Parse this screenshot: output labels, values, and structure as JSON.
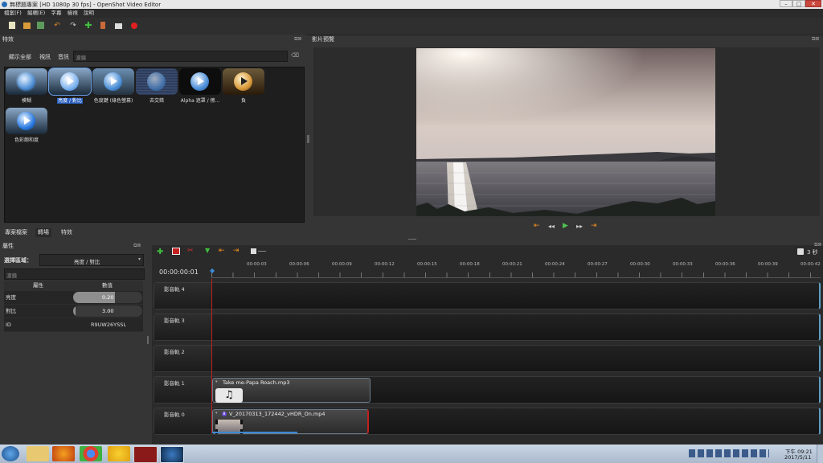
{
  "window": {
    "title": "無標題專案 [HD 1080p 30 fps] - OpenShot Video Editor"
  },
  "menu": [
    "檔案(F)",
    "編輯(E)",
    "字幕",
    "檢視",
    "說明"
  ],
  "effects": {
    "title": "特效",
    "filters": {
      "show_all": "顯示全部",
      "video": "視訊",
      "audio": "音訊",
      "search_placeholder": "濾鏡"
    },
    "items": [
      {
        "label": "模糊",
        "selected": false
      },
      {
        "label": "亮度 / 對比",
        "selected": true
      },
      {
        "label": "色度鍵 (綠色螢幕)",
        "selected": false
      },
      {
        "label": "去交錯",
        "selected": false
      },
      {
        "label": "Alpha 遮罩 / 擦...",
        "selected": false
      },
      {
        "label": "負",
        "selected": false
      },
      {
        "label": "色彩飽和度",
        "selected": false
      }
    ]
  },
  "preview": {
    "title": "影片預覽"
  },
  "tabs": {
    "project_files": "專案檔案",
    "transitions": "轉場",
    "effects": "特效"
  },
  "properties": {
    "title": "屬性",
    "selection_label": "選擇區域：",
    "selection_value": "亮度 / 對比",
    "filter_placeholder": "濾鏡",
    "col_property": "屬性",
    "col_value": "數值",
    "rows": [
      {
        "name": "亮度",
        "value": "0.20",
        "fill": 0.6
      },
      {
        "name": "對比",
        "value": "3.00",
        "fill": 0.03
      },
      {
        "name": "ID",
        "value": "R9UW26YSSL"
      }
    ]
  },
  "timeline": {
    "current_time": "00:00:00:01",
    "zoom_label": "3 秒",
    "ticks": [
      "00:00:03",
      "00:00:06",
      "00:00:09",
      "00:00:12",
      "00:00:15",
      "00:00:18",
      "00:00:21",
      "00:00:24",
      "00:00:27",
      "00:00:30",
      "00:00:33",
      "00:00:36",
      "00:00:39",
      "00:00:42"
    ],
    "tracks": [
      "影音軌 4",
      "影音軌 3",
      "影音軌 2",
      "影音軌 1",
      "影音軌 0"
    ],
    "clips": {
      "audio": "Take me-Papa Roach.mp3",
      "video": "V_20170313_172442_vHDR_On.mp4"
    }
  },
  "taskbar": {
    "time": "下午 09:21",
    "date": "2017/5/11"
  },
  "colors": {
    "accent": "#2a60c0",
    "playhead": "#c02020",
    "track_edge": "#5f9fc5"
  }
}
